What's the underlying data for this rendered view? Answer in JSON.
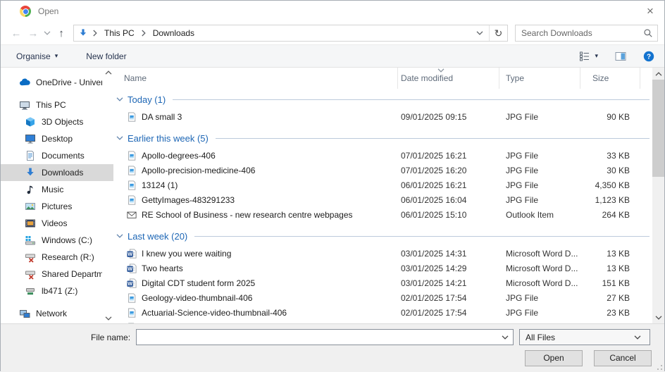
{
  "window": {
    "title": "Open"
  },
  "icons": {
    "back-icon": "←",
    "forward-icon": "→",
    "up-icon": "↑",
    "refresh-icon": "↻",
    "close-icon": "×",
    "dropdown-triangle": "▾"
  },
  "nav": {
    "breadcrumb": {
      "root": "This PC",
      "current": "Downloads"
    },
    "search_placeholder": "Search Downloads"
  },
  "toolbar": {
    "organise_label": "Organise",
    "new_folder_label": "New folder"
  },
  "sidebar": {
    "items": [
      {
        "label": "OneDrive - Univer",
        "icon": "onedrive-cloud-icon",
        "level": 0
      },
      {
        "label": "This PC",
        "icon": "computer-icon",
        "level": 0,
        "gap_before": true
      },
      {
        "label": "3D Objects",
        "icon": "3d-objects-icon",
        "level": 1
      },
      {
        "label": "Desktop",
        "icon": "desktop-icon",
        "level": 1
      },
      {
        "label": "Documents",
        "icon": "documents-icon",
        "level": 1
      },
      {
        "label": "Downloads",
        "icon": "downloads-icon",
        "level": 1,
        "selected": true
      },
      {
        "label": "Music",
        "icon": "music-icon",
        "level": 1
      },
      {
        "label": "Pictures",
        "icon": "pictures-icon",
        "level": 1
      },
      {
        "label": "Videos",
        "icon": "videos-icon",
        "level": 1
      },
      {
        "label": "Windows (C:)",
        "icon": "windows-drive-icon",
        "level": 1
      },
      {
        "label": "Research (R:)",
        "icon": "disconnected-drive-icon",
        "level": 1
      },
      {
        "label": "Shared Departm",
        "icon": "disconnected-drive-icon",
        "level": 1
      },
      {
        "label": "lb471 (Z:)",
        "icon": "network-drive-icon",
        "level": 1
      },
      {
        "label": "Network",
        "icon": "network-icon",
        "level": 0,
        "gap_before": true
      }
    ]
  },
  "list": {
    "columns": [
      {
        "label": "Name"
      },
      {
        "label": "Date modified",
        "sorted": true
      },
      {
        "label": "Type"
      },
      {
        "label": "Size"
      }
    ],
    "groups": [
      {
        "label": "Today (1)",
        "files": [
          {
            "name": "DA small 3",
            "date": "09/01/2025 09:15",
            "type": "JPG File",
            "size": "90 KB",
            "icon": "jpg-file-icon"
          }
        ]
      },
      {
        "label": "Earlier this week (5)",
        "files": [
          {
            "name": "Apollo-degrees-406",
            "date": "07/01/2025 16:21",
            "type": "JPG File",
            "size": "33 KB",
            "icon": "jpg-file-icon"
          },
          {
            "name": "Apollo-precision-medicine-406",
            "date": "07/01/2025 16:20",
            "type": "JPG File",
            "size": "30 KB",
            "icon": "jpg-file-icon"
          },
          {
            "name": "13124 (1)",
            "date": "06/01/2025 16:21",
            "type": "JPG File",
            "size": "4,350 KB",
            "icon": "jpg-file-icon"
          },
          {
            "name": "GettyImages-483291233",
            "date": "06/01/2025 16:04",
            "type": "JPG File",
            "size": "1,123 KB",
            "icon": "jpg-file-icon"
          },
          {
            "name": "RE School of Business - new research centre webpages",
            "date": "06/01/2025 15:10",
            "type": "Outlook Item",
            "size": "264 KB",
            "icon": "outlook-item-icon"
          }
        ]
      },
      {
        "label": "Last week (20)",
        "files": [
          {
            "name": "I knew you were waiting",
            "date": "03/01/2025 14:31",
            "type": "Microsoft Word D...",
            "size": "13 KB",
            "icon": "word-file-icon"
          },
          {
            "name": "Two hearts",
            "date": "03/01/2025 14:29",
            "type": "Microsoft Word D...",
            "size": "13 KB",
            "icon": "word-file-icon"
          },
          {
            "name": "Digital CDT student form 2025",
            "date": "03/01/2025 14:21",
            "type": "Microsoft Word D...",
            "size": "151 KB",
            "icon": "word-file-icon"
          },
          {
            "name": "Geology-video-thumbnail-406",
            "date": "02/01/2025 17:54",
            "type": "JPG File",
            "size": "27 KB",
            "icon": "jpg-file-icon"
          },
          {
            "name": "Actuarial-Science-video-thumbnail-406",
            "date": "02/01/2025 17:54",
            "type": "JPG File",
            "size": "23 KB",
            "icon": "jpg-file-icon"
          }
        ]
      }
    ],
    "partial_row": true
  },
  "footer": {
    "file_name_label": "File name:",
    "file_name_value": "",
    "file_type_selected": "All Files",
    "open_label": "Open",
    "cancel_label": "Cancel"
  },
  "colors": {
    "accent_blue": "#1d66b5",
    "command_text": "#27344f",
    "selection_gray": "#d9d9d9",
    "help_blue": "#1373cf"
  }
}
